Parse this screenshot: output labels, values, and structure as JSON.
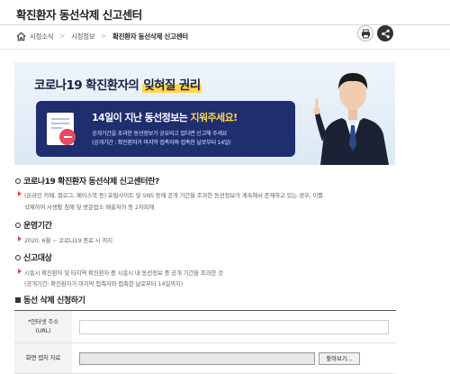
{
  "header": {
    "title": "확진환자 동선삭제 신고센터"
  },
  "breadcrumb": {
    "items": [
      "시정소식",
      "시정정보",
      "확진환자 동선삭제 신고센터"
    ]
  },
  "banner": {
    "title_prefix": "코로나19 확진환자의 ",
    "title_highlight": "잊혀질 권리",
    "headline_prefix": "14일이 지난 동선정보는 ",
    "headline_highlight": "지워주세요!",
    "sub1": "공개기간을 초과한 동선정보가 공유되고 있다면 신고해 주세요",
    "sub2": "(공개기간 : 확진환자가 마지막 접촉자와 접촉한 날로부터 14일)"
  },
  "sections": {
    "what": {
      "title": "코로나19 확진환자 동선삭제 신고센터란?",
      "line1": "(온라인 카페, 블로그, 페이스북 등) 포털사이트 및 SNS 등에 공개 기간을 조과한 동선정보가 계속해서 존재하고 있는 경우, 이를",
      "line2": "삭제하여 사생활 침해 및 방문업소 매출저하 등 2차피해"
    },
    "period": {
      "title": "운영기간",
      "line1": "2020. 6월 ~ 코로나19 종료 시 까지"
    },
    "target": {
      "title": "신고대상",
      "line1": "시흥시 확진환자 및 타지역 확진환자 중 시흥시 내 동선정보 중 공개 기간을 조과한 것",
      "line2": "(공개기간: 확진환자가 마지막 접촉자와 접촉한 날로부터 14일까지)"
    },
    "apply": {
      "title": "동선 삭제 신청하기"
    }
  },
  "form": {
    "url_label_1": "*인터넷 주소",
    "url_label_2": "(URL)",
    "url_value": "",
    "capture_label": "화면 캡처 자료",
    "browse_label": "찾아보기..."
  },
  "colors": {
    "navy": "#1f2e6e",
    "highlight": "#ffd84d",
    "bullet": "#e04c3c"
  }
}
